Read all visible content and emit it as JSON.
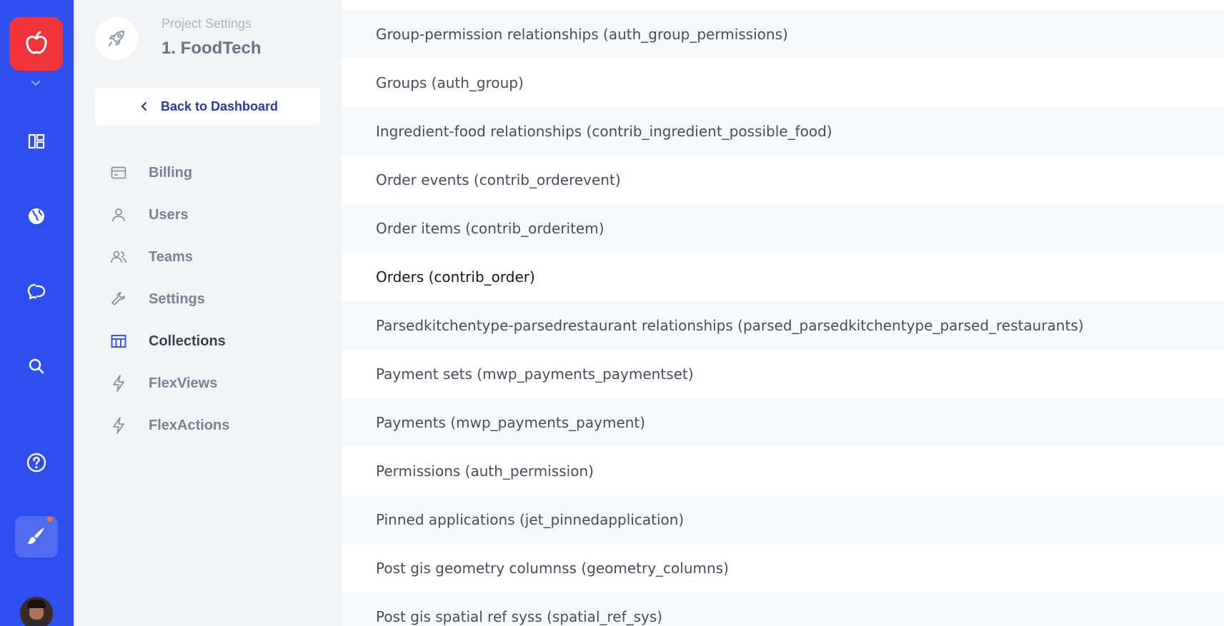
{
  "rail": {
    "app_logo_icon": "apple-icon",
    "items": [
      {
        "name": "dashboard-icon"
      },
      {
        "name": "globe-icon"
      },
      {
        "name": "chat-icon"
      },
      {
        "name": "search-icon"
      },
      {
        "name": "help-icon"
      },
      {
        "name": "brush-icon"
      }
    ],
    "brush_badge_color": "#ff6a3c",
    "accent": "#2e4ff0",
    "logo_color": "#f2343b"
  },
  "sidebar": {
    "subtitle": "Project Settings",
    "project_name": "1. FoodTech",
    "back_label": "Back to Dashboard",
    "items": [
      {
        "label": "Billing",
        "icon": "credit-card-icon"
      },
      {
        "label": "Users",
        "icon": "user-icon"
      },
      {
        "label": "Teams",
        "icon": "team-icon"
      },
      {
        "label": "Settings",
        "icon": "wrench-icon"
      },
      {
        "label": "Collections",
        "icon": "table-icon",
        "active": true
      },
      {
        "label": "FlexViews",
        "icon": "lightning-icon"
      },
      {
        "label": "FlexActions",
        "icon": "lightning-icon"
      }
    ]
  },
  "collections": [
    "Group-permission relationships (auth_group_permissions)",
    "Groups (auth_group)",
    "Ingredient-food relationships (contrib_ingredient_possible_food)",
    "Order events (contrib_orderevent)",
    "Order items (contrib_orderitem)",
    "Orders (contrib_order)",
    "Parsedkitchentype-parsedrestaurant relationships (parsed_parsedkitchentype_parsed_restaurants)",
    "Payment sets (mwp_payments_paymentset)",
    "Payments (mwp_payments_payment)",
    "Permissions (auth_permission)",
    "Pinned applications (jet_pinnedapplication)",
    "Post gis geometry columnss (geometry_columns)",
    "Post gis spatial ref syss (spatial_ref_sys)"
  ]
}
